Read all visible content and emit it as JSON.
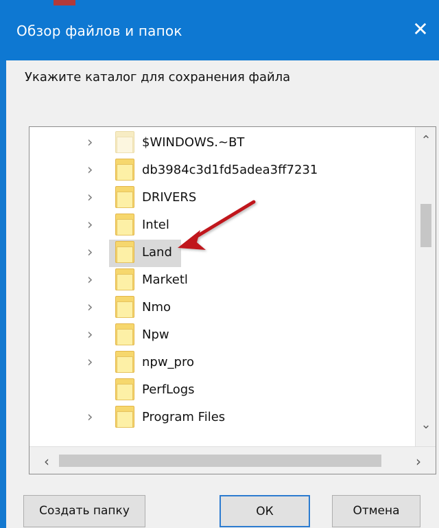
{
  "window": {
    "title": "Обзор файлов и папок",
    "close_symbol": "✕",
    "prompt": "Укажите каталог для сохранения файла"
  },
  "tree": {
    "items": [
      {
        "label": "$WINDOWS.~BT",
        "expandable": true,
        "selected": false,
        "folder_style": "light"
      },
      {
        "label": "db3984c3d1fd5adea3ff7231",
        "expandable": true,
        "selected": false,
        "folder_style": "normal"
      },
      {
        "label": "DRIVERS",
        "expandable": true,
        "selected": false,
        "folder_style": "normal"
      },
      {
        "label": "Intel",
        "expandable": true,
        "selected": false,
        "folder_style": "normal"
      },
      {
        "label": "Land",
        "expandable": true,
        "selected": true,
        "folder_style": "normal"
      },
      {
        "label": "Marketl",
        "expandable": true,
        "selected": false,
        "folder_style": "normal"
      },
      {
        "label": "Nmo",
        "expandable": true,
        "selected": false,
        "folder_style": "normal"
      },
      {
        "label": "Npw",
        "expandable": true,
        "selected": false,
        "folder_style": "normal"
      },
      {
        "label": "npw_pro",
        "expandable": true,
        "selected": false,
        "folder_style": "normal"
      },
      {
        "label": "PerfLogs",
        "expandable": false,
        "selected": false,
        "folder_style": "normal"
      },
      {
        "label": "Program Files",
        "expandable": true,
        "selected": false,
        "folder_style": "normal"
      }
    ]
  },
  "buttons": {
    "create_folder": "Создать папку",
    "ok": "ОК",
    "cancel": "Отмена"
  },
  "colors": {
    "titlebar": "#0e78d2",
    "window_bg": "#f0f0f0",
    "selection": "#d9d9d9",
    "arrow": "#c0141b",
    "primary_border": "#2b7bd0"
  },
  "icons": {
    "close": "close-icon",
    "expand": "chevron-right-icon",
    "folder": "folder-icon",
    "scroll_up": "chevron-up-icon",
    "scroll_down": "chevron-down-icon",
    "scroll_left": "chevron-left-icon",
    "scroll_right": "chevron-right-icon"
  }
}
